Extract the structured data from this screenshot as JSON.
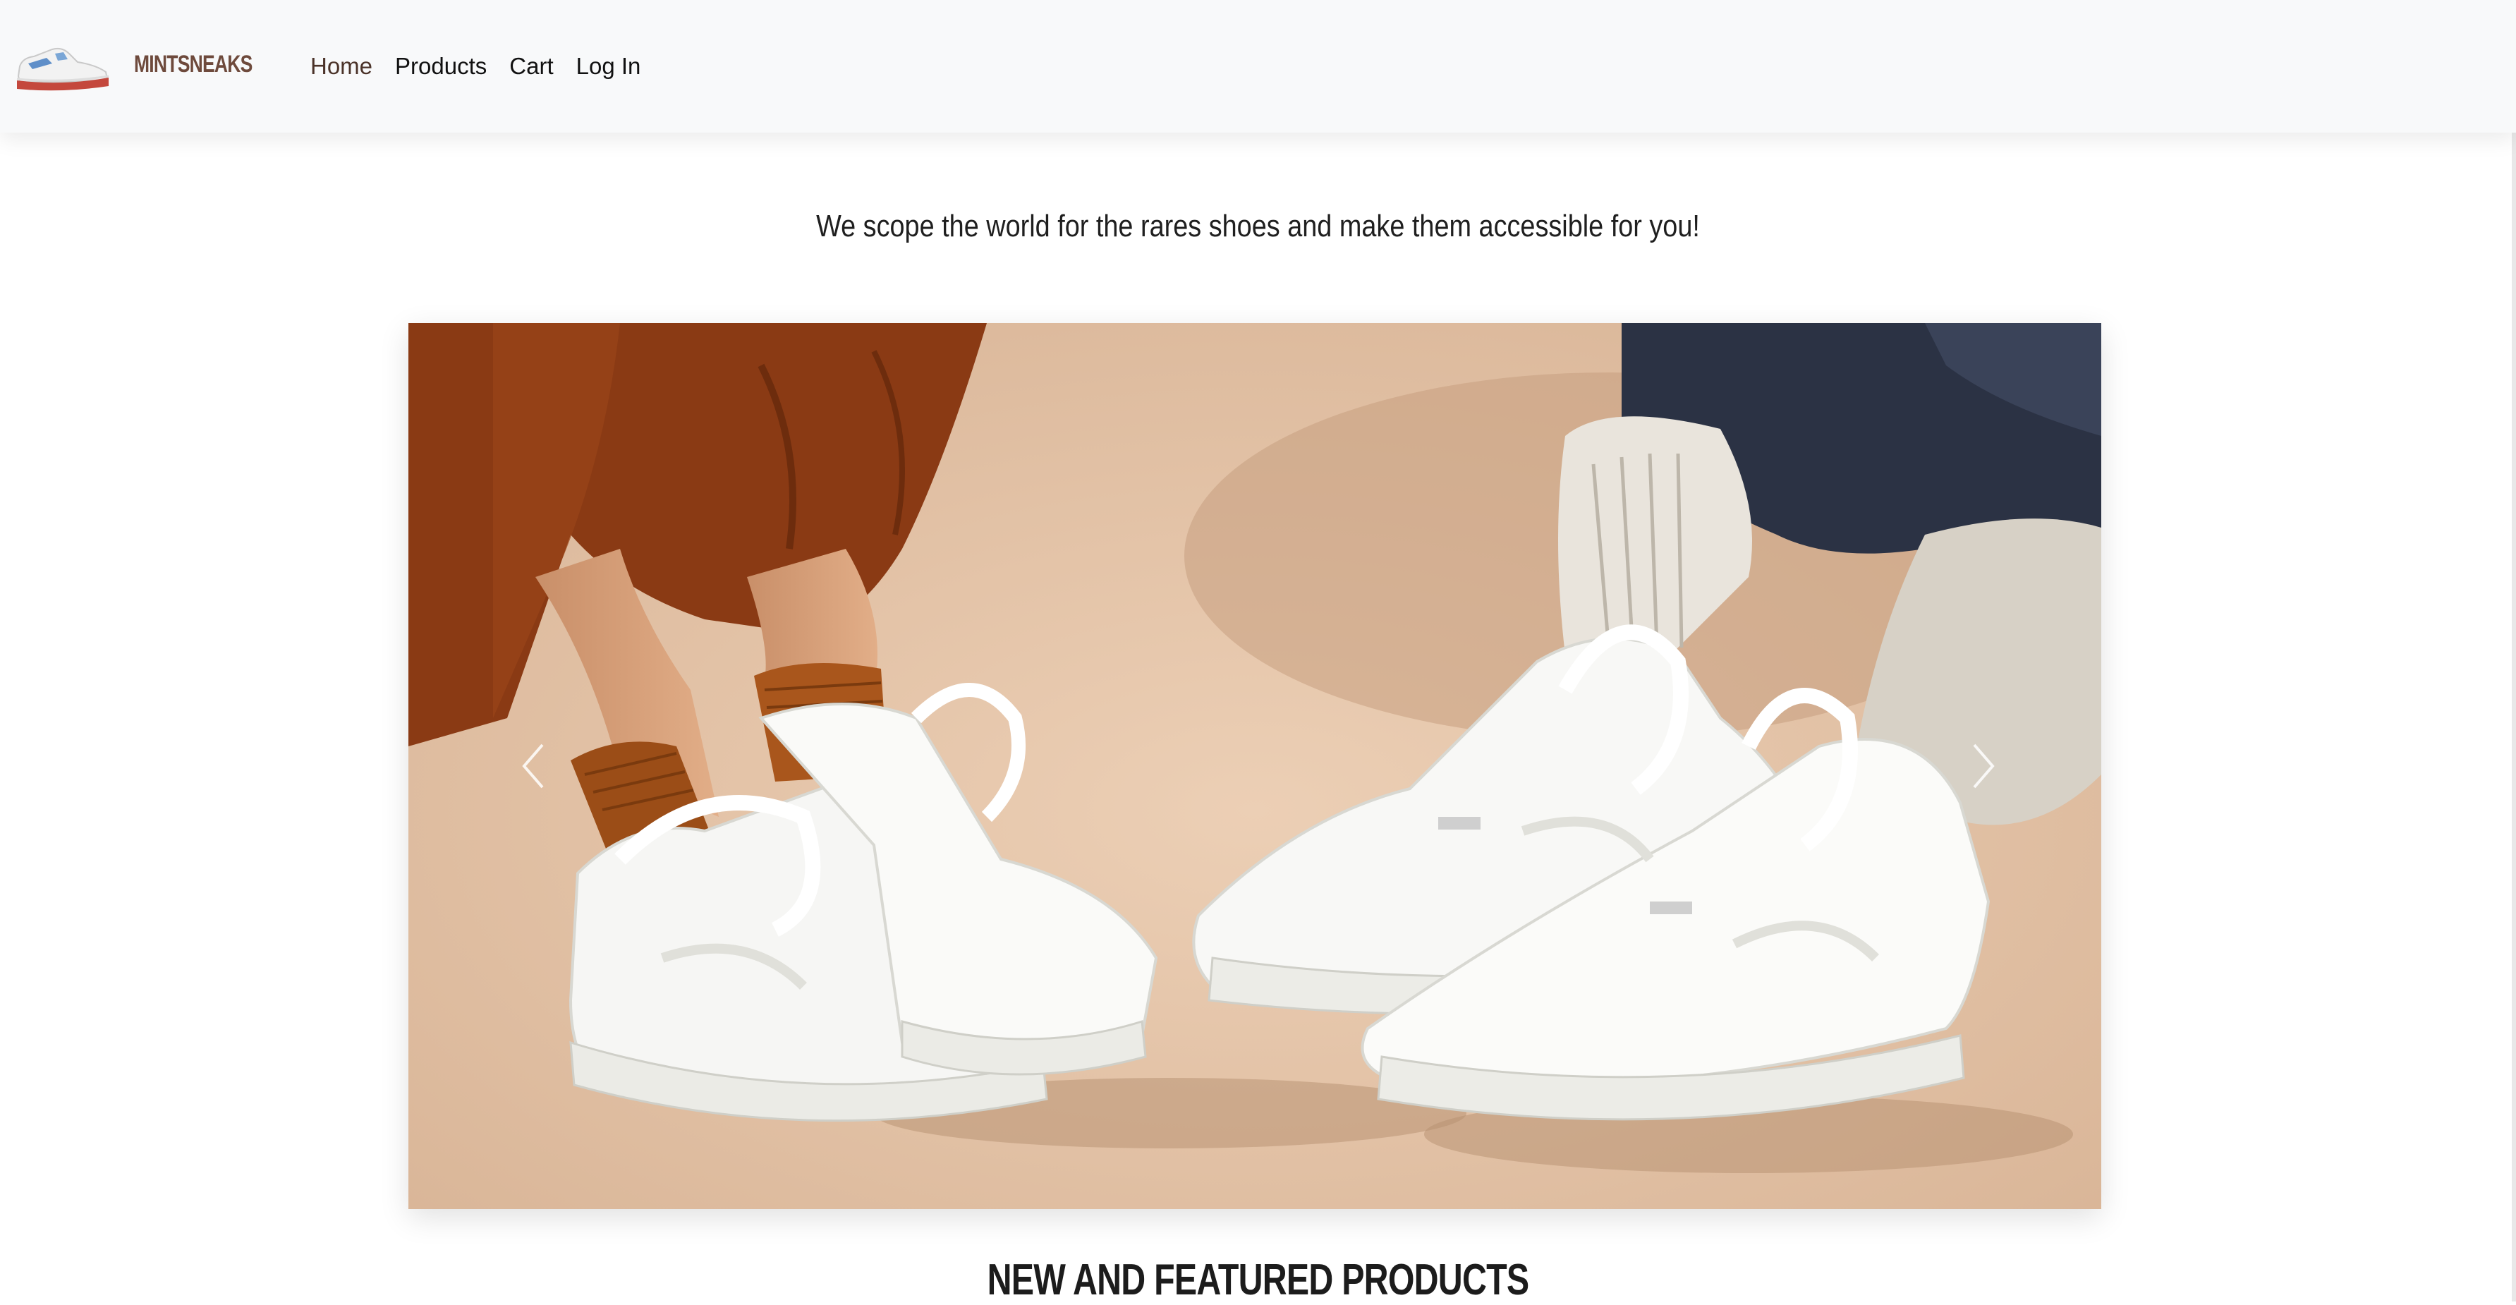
{
  "brand": {
    "name": "MINTSNEAKS",
    "logo_icon": "sneaker-logo-icon"
  },
  "nav": {
    "items": [
      {
        "label": "Home",
        "active": true
      },
      {
        "label": "Products",
        "active": false
      },
      {
        "label": "Cart",
        "active": false
      },
      {
        "label": "Log In",
        "active": false
      }
    ]
  },
  "hero": {
    "tagline": "We scope the world for the rares shoes and make them accessible for you!",
    "carousel": {
      "prev_icon": "chevron-left-icon",
      "next_icon": "chevron-right-icon",
      "image_subject": "white-sneakers-photo"
    }
  },
  "featured": {
    "heading": "NEW AND FEATURED PRODUCTS"
  },
  "colors": {
    "navbar_bg": "#f8f9fa",
    "brand_color": "#6e4a3c",
    "photo_backdrop": "#e3c3a7"
  }
}
